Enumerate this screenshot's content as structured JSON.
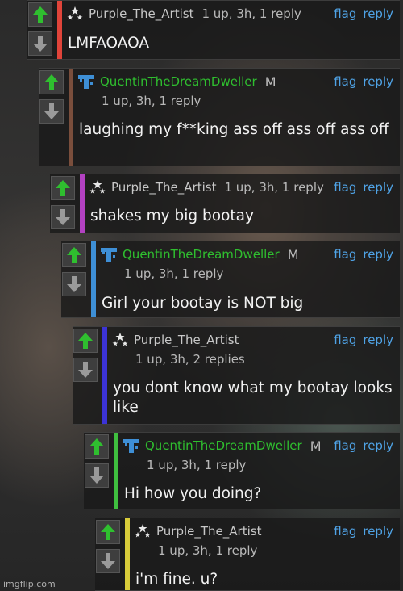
{
  "comments": [
    {
      "username": "Purple_The_Artist",
      "meta": "1 up, 3h, 1 reply",
      "text": "LMFAOAOA",
      "bar_color": "#e0443a",
      "flag": "flag",
      "reply": "reply"
    },
    {
      "username": "QuentinTheDreamDweller",
      "mod": "M",
      "meta": "1 up, 3h, 1 reply",
      "text": "laughing my f**king ass off ass off ass off",
      "bar_color": "#7a4e3c",
      "flag": "flag",
      "reply": "reply"
    },
    {
      "username": "Purple_The_Artist",
      "meta": "1 up, 3h, 1 reply",
      "text": "shakes my big bootay",
      "bar_color": "#b341c2",
      "flag": "flag",
      "reply": "reply"
    },
    {
      "username": "QuentinTheDreamDweller",
      "mod": "M",
      "meta": "1 up, 3h, 1 reply",
      "text": "Girl your bootay is NOT big",
      "bar_color": "#3e8fd6",
      "flag": "flag",
      "reply": "reply"
    },
    {
      "username": "Purple_The_Artist",
      "meta": "1 up, 3h, 2 replies",
      "text": "you dont know what my bootay looks like",
      "bar_color": "#3c33d6",
      "flag": "flag",
      "reply": "reply"
    },
    {
      "username": "QuentinTheDreamDweller",
      "mod": "M",
      "meta": "1 up, 3h, 1 reply",
      "text": "Hi how you doing?",
      "bar_color": "#3fbf3f",
      "flag": "flag",
      "reply": "reply"
    },
    {
      "username": "Purple_The_Artist",
      "meta": "1 up, 3h, 1 reply",
      "text": "i'm fine. u?",
      "bar_color": "#d8cc3a",
      "flag": "flag",
      "reply": "reply"
    }
  ],
  "watermark": "imgflip.com",
  "colors": {
    "link": "#4fa3e6",
    "upvote": "#2fbf2f",
    "mod_username": "#2fbf2f"
  },
  "icons": {
    "upvote": "arrow-up-icon",
    "downvote": "arrow-down-icon",
    "purple_avatar": "stars-avatar-icon",
    "quentin_avatar": "pixel-t-avatar-icon"
  }
}
